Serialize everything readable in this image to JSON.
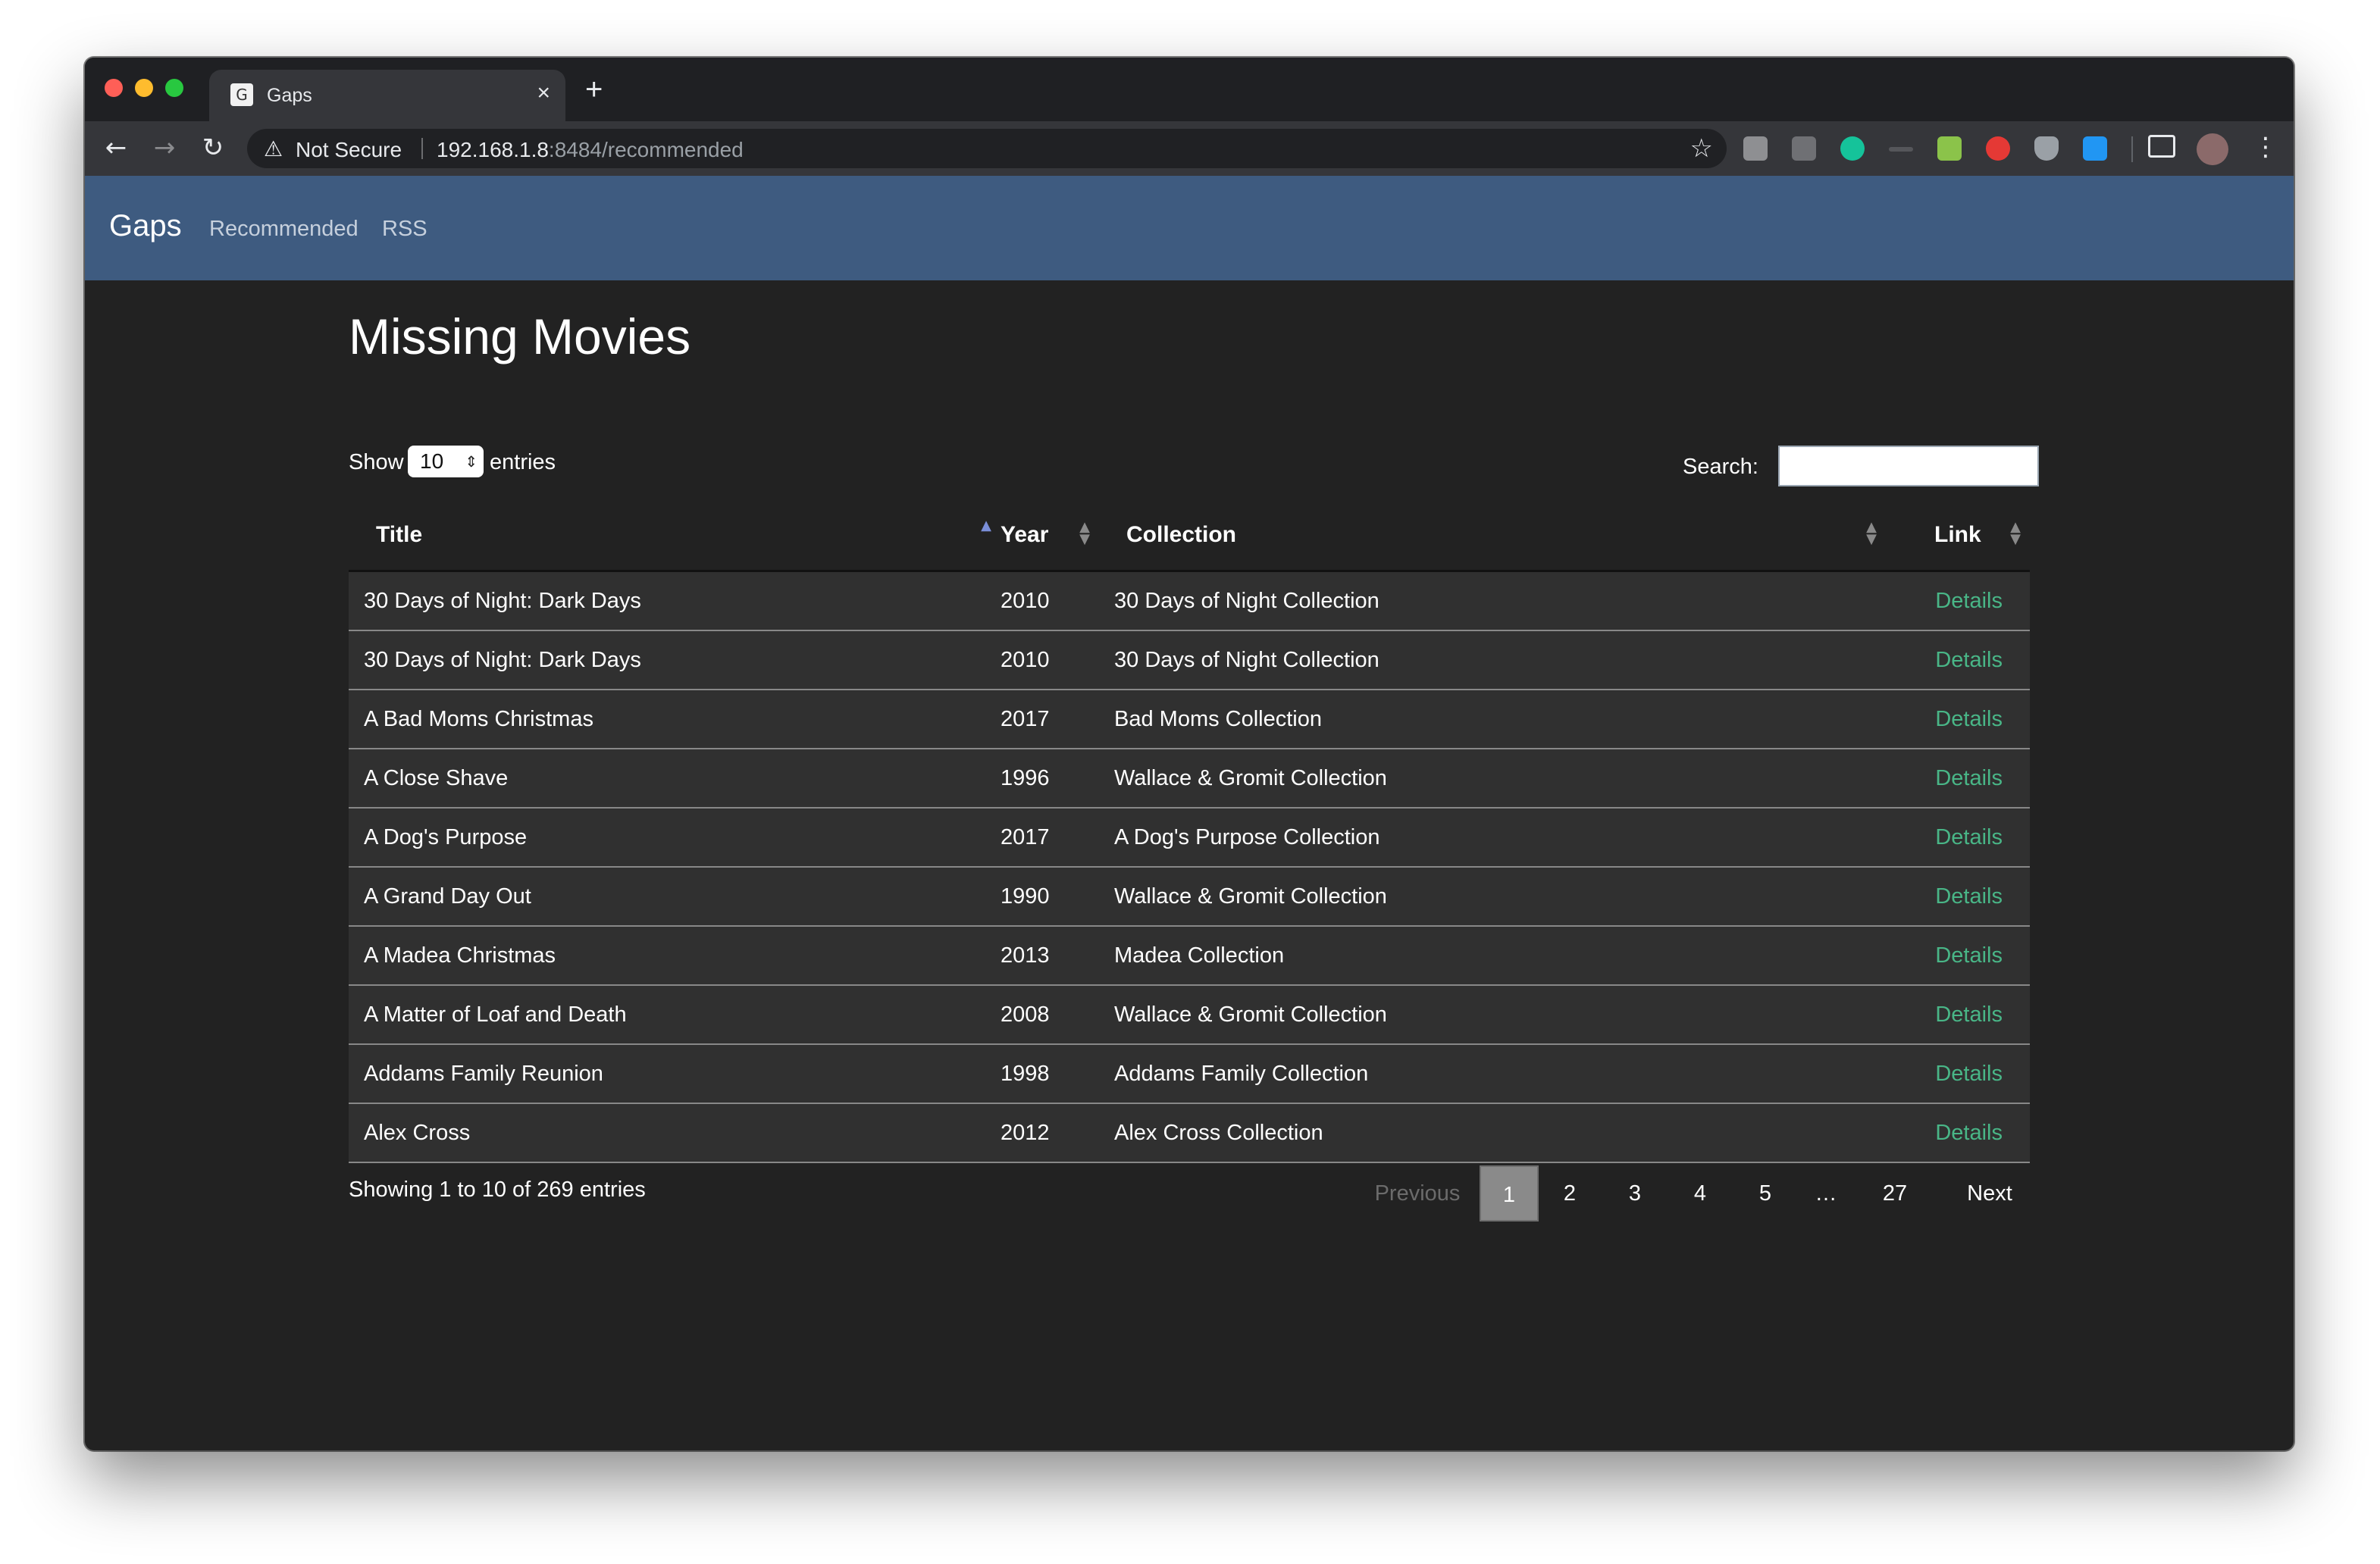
{
  "browser": {
    "tab_title": "Gaps",
    "favicon_text": "G",
    "security_label": "Not Secure",
    "url_host": "192.168.1.8",
    "url_rest": ":8484/recommended"
  },
  "app_nav": {
    "brand": "Gaps",
    "links": [
      "Recommended",
      "RSS"
    ],
    "bar_color": "#3e5b80"
  },
  "page": {
    "title": "Missing Movies",
    "length": {
      "show_label": "Show",
      "value": "10",
      "entries_label": "entries"
    },
    "search_label": "Search:",
    "search_value": ""
  },
  "table": {
    "columns": [
      "Title",
      "Year",
      "Collection",
      "Link"
    ],
    "sorted_column": "Title",
    "rows": [
      {
        "title": "30 Days of Night: Dark Days",
        "year": "2010",
        "collection": "30 Days of Night Collection",
        "link": "Details"
      },
      {
        "title": "30 Days of Night: Dark Days",
        "year": "2010",
        "collection": "30 Days of Night Collection",
        "link": "Details"
      },
      {
        "title": "A Bad Moms Christmas",
        "year": "2017",
        "collection": "Bad Moms Collection",
        "link": "Details"
      },
      {
        "title": "A Close Shave",
        "year": "1996",
        "collection": "Wallace & Gromit Collection",
        "link": "Details"
      },
      {
        "title": "A Dog's Purpose",
        "year": "2017",
        "collection": "A Dog's Purpose Collection",
        "link": "Details"
      },
      {
        "title": "A Grand Day Out",
        "year": "1990",
        "collection": "Wallace & Gromit Collection",
        "link": "Details"
      },
      {
        "title": "A Madea Christmas",
        "year": "2013",
        "collection": "Madea Collection",
        "link": "Details"
      },
      {
        "title": "A Matter of Loaf and Death",
        "year": "2008",
        "collection": "Wallace & Gromit Collection",
        "link": "Details"
      },
      {
        "title": "Addams Family Reunion",
        "year": "1998",
        "collection": "Addams Family Collection",
        "link": "Details"
      },
      {
        "title": "Alex Cross",
        "year": "2012",
        "collection": "Alex Cross Collection",
        "link": "Details"
      }
    ]
  },
  "footer": {
    "info": "Showing 1 to 10 of 269 entries",
    "pagination": {
      "previous": "Previous",
      "pages": [
        "1",
        "2",
        "3",
        "4",
        "5",
        "…",
        "27"
      ],
      "current": "1",
      "next": "Next"
    }
  },
  "colors": {
    "link": "#49b687",
    "background": "#222222",
    "row": "#303030"
  }
}
